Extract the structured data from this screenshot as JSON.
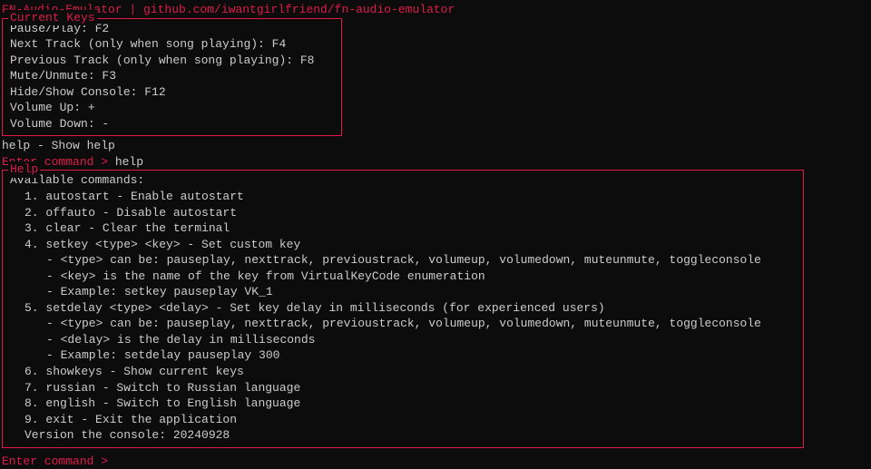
{
  "header": "FN-Audio-Emulator | github.com/iwantgirlfriend/fn-audio-emulator",
  "keys_box": {
    "title": "Current Keys",
    "lines": [
      "Pause/Play: F2",
      "Next Track (only when song playing): F4",
      "Previous Track (only when song playing): F8",
      "Mute/Unmute: F3",
      "Hide/Show Console: F12",
      "Volume Up: +",
      "Volume Down: -"
    ]
  },
  "help_hint": "help - Show help",
  "prompt1": {
    "prompt": "Enter command > ",
    "input": "help"
  },
  "help_box": {
    "title": "Help",
    "heading": "Available commands:",
    "items": [
      {
        "text": "1. autostart - Enable autostart",
        "indent": 1
      },
      {
        "text": "2. offauto - Disable autostart",
        "indent": 1
      },
      {
        "text": "3. clear - Clear the terminal",
        "indent": 1
      },
      {
        "text": "4. setkey <type> <key> - Set custom key",
        "indent": 1
      },
      {
        "text": "- <type> can be: pauseplay, nexttrack, previoustrack, volumeup, volumedown, muteunmute, toggleconsole",
        "indent": 2
      },
      {
        "text": "- <key> is the name of the key from VirtualKeyCode enumeration",
        "indent": 2
      },
      {
        "text": "- Example: setkey pauseplay VK_1",
        "indent": 2
      },
      {
        "text": "5. setdelay <type> <delay> - Set key delay in milliseconds (for experienced users)",
        "indent": 1
      },
      {
        "text": "- <type> can be: pauseplay, nexttrack, previoustrack, volumeup, volumedown, muteunmute, toggleconsole",
        "indent": 2
      },
      {
        "text": "- <delay> is the delay in milliseconds",
        "indent": 2
      },
      {
        "text": "- Example: setdelay pauseplay 300",
        "indent": 2
      },
      {
        "text": "6. showkeys - Show current keys",
        "indent": 1
      },
      {
        "text": "7. russian - Switch to Russian language",
        "indent": 1
      },
      {
        "text": "8. english - Switch to English language",
        "indent": 1
      },
      {
        "text": "9. exit - Exit the application",
        "indent": 1
      },
      {
        "text": "Version the console: 20240928",
        "indent": 1
      }
    ]
  },
  "prompt2": {
    "prompt": "Enter command > ",
    "input": ""
  }
}
